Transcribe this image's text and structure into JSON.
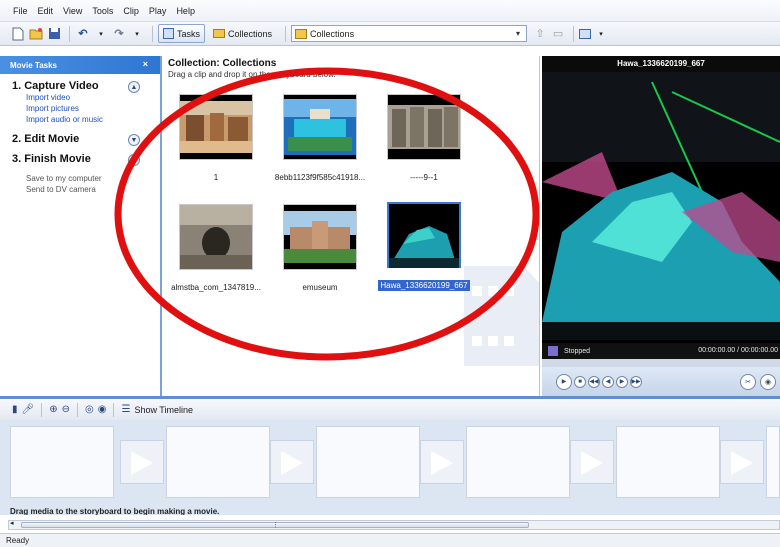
{
  "menu": [
    "File",
    "Edit",
    "View",
    "Tools",
    "Clip",
    "Play",
    "Help"
  ],
  "toolbar": {
    "tasks_label": "Tasks",
    "collections_label": "Collections",
    "combo_value": "Collections"
  },
  "tasks": {
    "header": "Movie Tasks",
    "close_glyph": "×",
    "sections": [
      {
        "title": "1. Capture Video",
        "links": [
          "Import video",
          "Import pictures",
          "Import audio or music"
        ]
      },
      {
        "title": "2. Edit Movie",
        "links": []
      },
      {
        "title": "3. Finish Movie",
        "links": [
          "Save to my computer",
          "Send to DV camera"
        ]
      }
    ]
  },
  "collection": {
    "title": "Collection: Collections",
    "subtitle": "Drag a clip and drop it on the storyboard below.",
    "clips": [
      {
        "caption": "1"
      },
      {
        "caption": "8ebb1123f9f585c41918..."
      },
      {
        "caption": "-----9--1"
      },
      {
        "caption": "almstba_com_1347819..."
      },
      {
        "caption": "emuseum"
      },
      {
        "caption": "Hawa_1336620199_667",
        "selected": true
      }
    ]
  },
  "preview": {
    "title": "Hawa_1336620199_667",
    "status": "Stopped",
    "time": "00:00:00.00 / 00:00:00.00"
  },
  "storyboard": {
    "show_timeline": "Show Timeline",
    "hint": "Drag media to the storyboard to begin making a movie."
  },
  "status_bar": "Ready",
  "colors": {
    "accent": "#2f76d2",
    "annotation": "#e01010",
    "selection": "#3366cc"
  }
}
